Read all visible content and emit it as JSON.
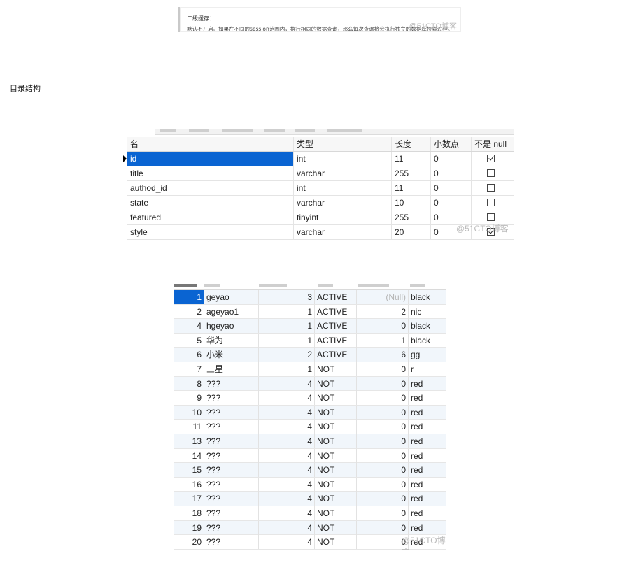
{
  "note": {
    "title": "二级缓存：",
    "body": "默认不开启。如果在不同的session范围内，执行相同的数据查询，那么每次查询将会执行独立的数据库检索过程。",
    "watermark": "@51CTO博客"
  },
  "section_heading": "目录结构",
  "structure_table": {
    "headers": [
      "名",
      "类型",
      "长度",
      "小数点",
      "不是 null"
    ],
    "rows": [
      {
        "name": "id",
        "type": "int",
        "length": "11",
        "decimals": "0",
        "not_null": true
      },
      {
        "name": "title",
        "type": "varchar",
        "length": "255",
        "decimals": "0",
        "not_null": false
      },
      {
        "name": "authod_id",
        "type": "int",
        "length": "11",
        "decimals": "0",
        "not_null": false
      },
      {
        "name": "state",
        "type": "varchar",
        "length": "10",
        "decimals": "0",
        "not_null": false
      },
      {
        "name": "featured",
        "type": "tinyint",
        "length": "255",
        "decimals": "0",
        "not_null": false
      },
      {
        "name": "style",
        "type": "varchar",
        "length": "20",
        "decimals": "0",
        "not_null": true
      }
    ],
    "watermark": "@51CTO博客"
  },
  "data_table": {
    "rows": [
      {
        "id": "1",
        "title": "geyao",
        "authod_id": "3",
        "state": "ACTIVE",
        "featured": "(Null)",
        "style": "black"
      },
      {
        "id": "2",
        "title": "ageyao1",
        "authod_id": "1",
        "state": "ACTIVE",
        "featured": "2",
        "style": "nic"
      },
      {
        "id": "4",
        "title": "hgeyao",
        "authod_id": "1",
        "state": "ACTIVE",
        "featured": "0",
        "style": "black"
      },
      {
        "id": "5",
        "title": "华为",
        "authod_id": "1",
        "state": "ACTIVE",
        "featured": "1",
        "style": "black"
      },
      {
        "id": "6",
        "title": "小米",
        "authod_id": "2",
        "state": "ACTIVE",
        "featured": "6",
        "style": "gg"
      },
      {
        "id": "7",
        "title": "三星",
        "authod_id": "1",
        "state": "NOT",
        "featured": "0",
        "style": "r"
      },
      {
        "id": "8",
        "title": "???",
        "authod_id": "4",
        "state": "NOT",
        "featured": "0",
        "style": "red"
      },
      {
        "id": "9",
        "title": "???",
        "authod_id": "4",
        "state": "NOT",
        "featured": "0",
        "style": "red"
      },
      {
        "id": "10",
        "title": "???",
        "authod_id": "4",
        "state": "NOT",
        "featured": "0",
        "style": "red"
      },
      {
        "id": "11",
        "title": "???",
        "authod_id": "4",
        "state": "NOT",
        "featured": "0",
        "style": "red"
      },
      {
        "id": "13",
        "title": "???",
        "authod_id": "4",
        "state": "NOT",
        "featured": "0",
        "style": "red"
      },
      {
        "id": "14",
        "title": "???",
        "authod_id": "4",
        "state": "NOT",
        "featured": "0",
        "style": "red"
      },
      {
        "id": "15",
        "title": "???",
        "authod_id": "4",
        "state": "NOT",
        "featured": "0",
        "style": "red"
      },
      {
        "id": "16",
        "title": "???",
        "authod_id": "4",
        "state": "NOT",
        "featured": "0",
        "style": "red"
      },
      {
        "id": "17",
        "title": "???",
        "authod_id": "4",
        "state": "NOT",
        "featured": "0",
        "style": "red"
      },
      {
        "id": "18",
        "title": "???",
        "authod_id": "4",
        "state": "NOT",
        "featured": "0",
        "style": "red"
      },
      {
        "id": "19",
        "title": "???",
        "authod_id": "4",
        "state": "NOT",
        "featured": "0",
        "style": "red"
      },
      {
        "id": "20",
        "title": "???",
        "authod_id": "4",
        "state": "NOT",
        "featured": "0",
        "style": "red"
      }
    ],
    "watermark": "@51CTO博客"
  },
  "colors": {
    "selection": "#0a64d2",
    "alt_row": "#f1f6fb",
    "null_text": "#b5b5b5"
  }
}
